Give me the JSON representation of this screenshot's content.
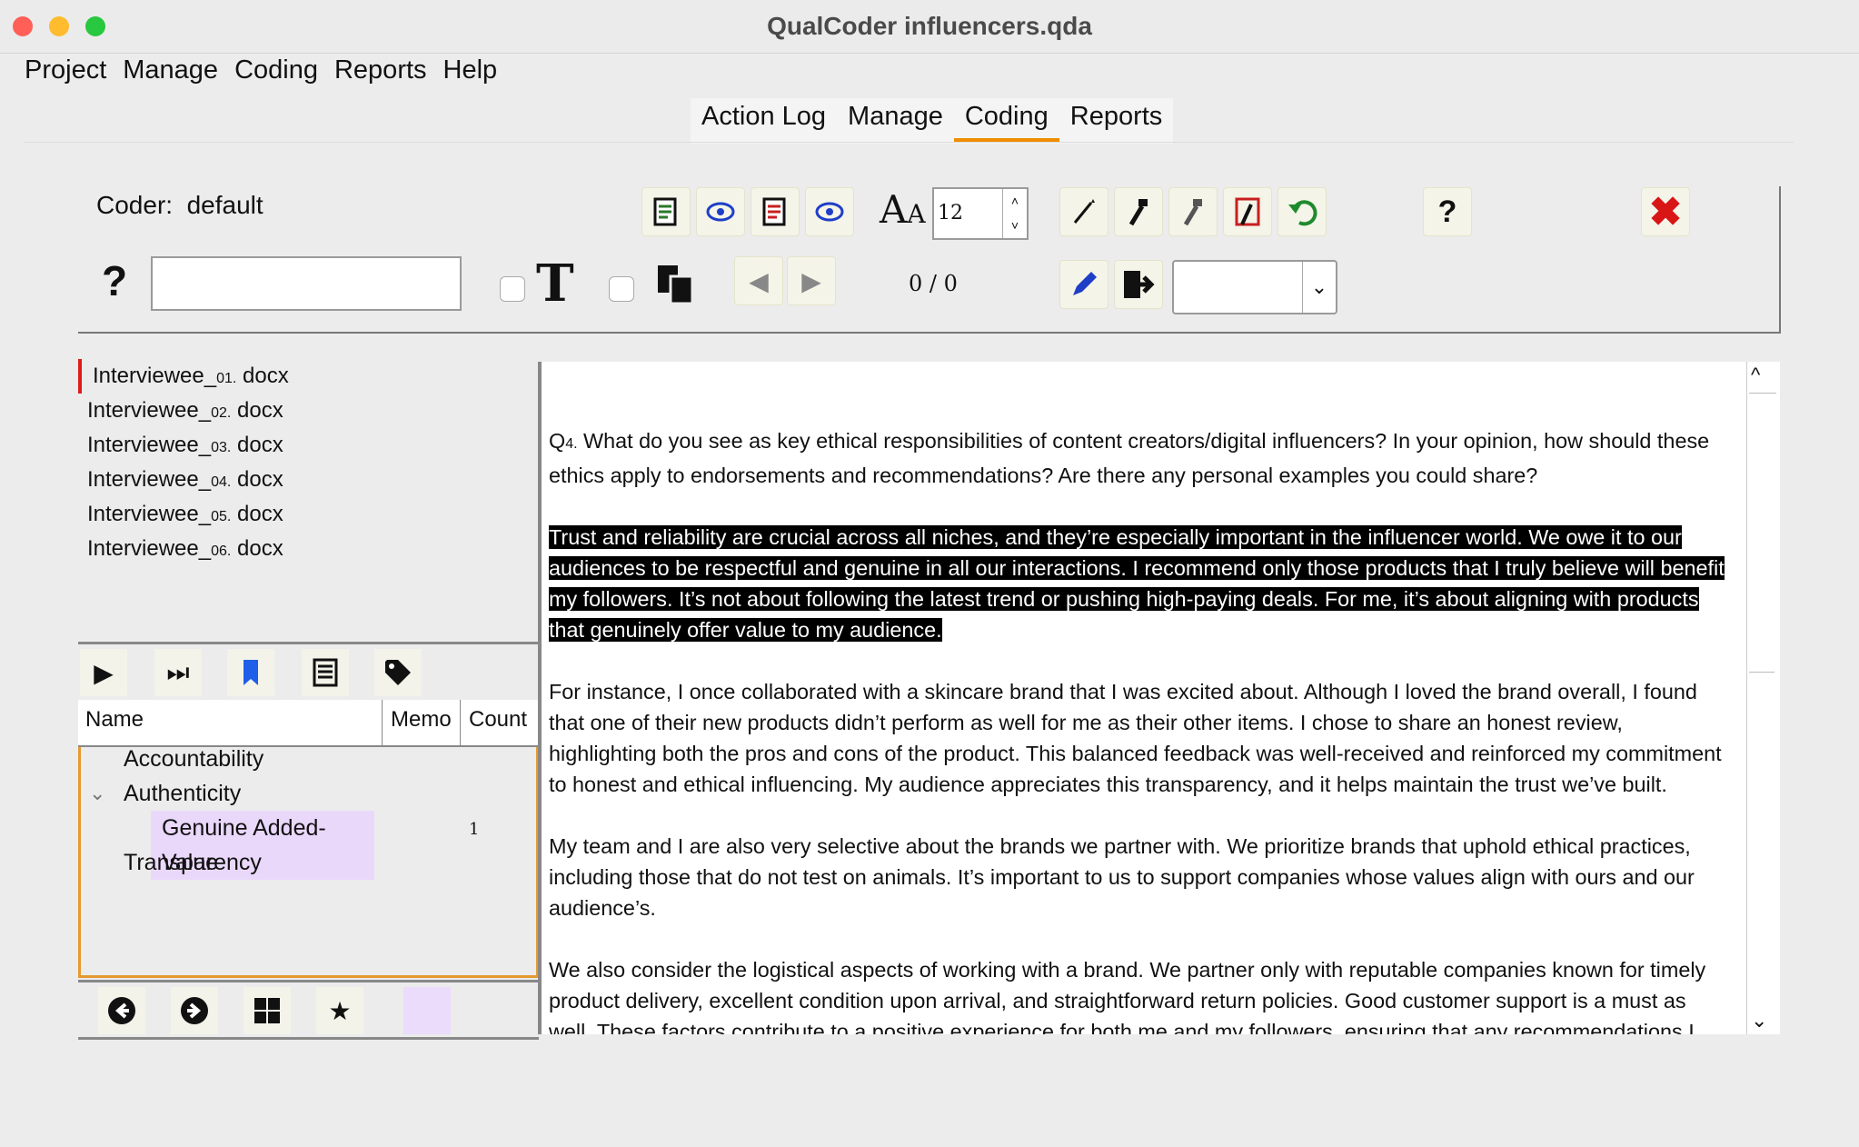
{
  "window": {
    "title": "QualCoder influencers.qda"
  },
  "menubar": [
    "Project",
    "Manage",
    "Coding",
    "Reports",
    "Help"
  ],
  "tabs": [
    {
      "label": "Action Log",
      "active": false
    },
    {
      "label": "Manage",
      "active": false
    },
    {
      "label": "Coding",
      "active": true
    },
    {
      "label": "Reports",
      "active": false
    }
  ],
  "coder": {
    "label": "Coder:",
    "value": "default"
  },
  "toolbar": {
    "font_size": "12",
    "search_placeholder": "",
    "match_counter": "0 / 0",
    "help_glyph": "?",
    "search_help_glyph": "?",
    "dropdown_value": ""
  },
  "files": [
    {
      "prefix": "Interviewee_",
      "num": "01.",
      "ext": " docx",
      "selected": true
    },
    {
      "prefix": "Interviewee_",
      "num": "02.",
      "ext": " docx",
      "selected": false
    },
    {
      "prefix": "Interviewee_",
      "num": "03.",
      "ext": " docx",
      "selected": false
    },
    {
      "prefix": "Interviewee_",
      "num": "04.",
      "ext": " docx",
      "selected": false
    },
    {
      "prefix": "Interviewee_",
      "num": "05.",
      "ext": " docx",
      "selected": false
    },
    {
      "prefix": "Interviewee_",
      "num": "06.",
      "ext": " docx",
      "selected": false
    }
  ],
  "code_tree": {
    "headers": {
      "name": "Name",
      "memo": "Memo",
      "count": "Count"
    },
    "rows": [
      {
        "name": "Accountability",
        "count": ""
      },
      {
        "name": "Authenticity",
        "count": "",
        "expanded": true
      },
      {
        "name": "Genuine Added-Value",
        "count": "1",
        "child": true,
        "color": "#ead8fb"
      },
      {
        "name": "Transparency",
        "count": ""
      }
    ]
  },
  "document": {
    "q_prefix": "Q",
    "q_num": "4.",
    "q_text": "  What do you see as key ethical responsibilities of content creators/digital influencers? In your opinion, how should these ethics apply to endorsements and recommendations? Are there any personal examples you could share?",
    "para1_highlighted": "Trust and reliability are crucial across all niches, and they’re especially important in the influencer world.  We owe it to our audiences to be respectful and genuine in all our interactions.  I recommend only those products that I truly believe will benefit my followers.  It’s not about following the latest trend or pushing high-paying deals.  For me, it’s about aligning with products that genuinely offer value to my audience.",
    "para2": "For instance, I once collaborated with a skincare brand that I was excited about.  Although I loved the brand overall, I found that one of their new products didn’t perform as well for me as their other items.  I chose to share an honest review, highlighting both the pros and cons of the product.  This balanced feedback was well-received and reinforced my commitment to honest and ethical influencing.  My audience appreciates this transparency, and it helps maintain the trust we’ve built.",
    "para3": "My team and I are also very selective about the brands we partner with.  We prioritize brands that uphold ethical practices, including those that do not test on animals.  It’s important to us to support companies whose values align with ours and our audience’s.",
    "para4": "We also consider the logistical aspects of working with a brand.  We partner only with reputable companies known for timely product delivery, excellent condition upon arrival, and straightforward return policies.  Good customer support is a must as well.  These factors contribute to a positive experience for both me and my followers, ensuring that any recommendations I"
  },
  "colors": {
    "tab_active": "#f08c00",
    "selected_file": "#e01b1b",
    "tree_border": "#e49a2f",
    "code_color": "#ead8fb"
  }
}
